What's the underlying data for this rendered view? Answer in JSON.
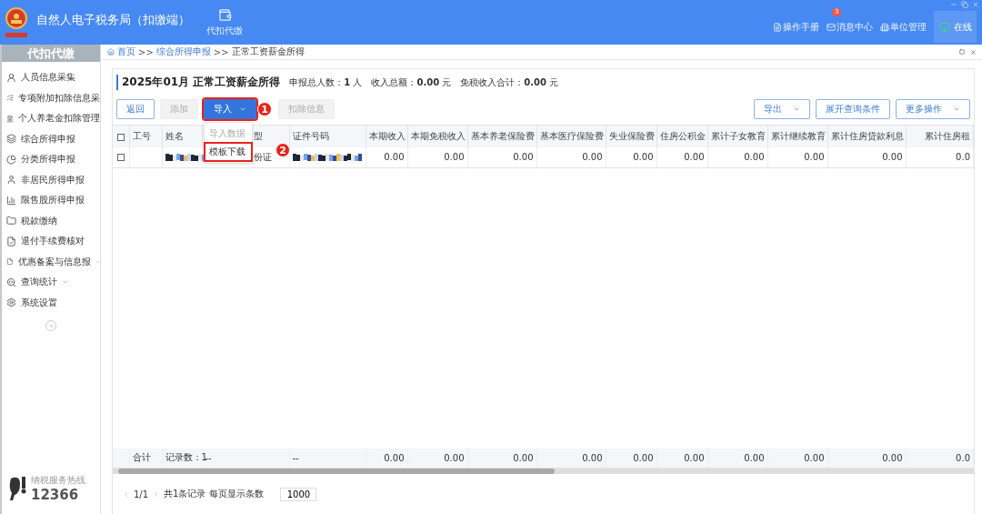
{
  "header": {
    "title": "自然人电子税务局（扣缴端）",
    "nav_tab": {
      "label": "代扣代缴",
      "selected": true
    },
    "links": [
      {
        "label": "操作手册"
      },
      {
        "label": "消息中心",
        "badge": "3"
      },
      {
        "label": "单位管理"
      }
    ],
    "status": "在线"
  },
  "sidebar": {
    "title": "代扣代缴",
    "items": [
      {
        "label": "人员信息采集",
        "expandable": false
      },
      {
        "label": "专项附加扣除信息采",
        "expandable": false
      },
      {
        "label": "个人养老金扣除管理",
        "expandable": false
      },
      {
        "label": "综合所得申报",
        "expandable": false
      },
      {
        "label": "分类所得申报",
        "expandable": false
      },
      {
        "label": "非居民所得申报",
        "expandable": false
      },
      {
        "label": "限售股所得申报",
        "expandable": false
      },
      {
        "label": "税款缴纳",
        "expandable": false
      },
      {
        "label": "退付手续费核对",
        "expandable": false
      },
      {
        "label": "优惠备案与信息报",
        "expandable": true
      },
      {
        "label": "查询统计",
        "expandable": true
      },
      {
        "label": "系统设置",
        "expandable": false
      }
    ],
    "hotline": {
      "caption": "纳税服务热线",
      "number": "12366"
    }
  },
  "breadcrumb": {
    "separator": ">>",
    "items": [
      "首页",
      "综合所得申报",
      "正常工资薪金所得"
    ]
  },
  "summary": {
    "title": "2025年01月 正常工资薪金所得",
    "stats": [
      {
        "label": "申报总人数：",
        "value": "1",
        "unit": "人"
      },
      {
        "label": "收入总额：",
        "value": "0.00",
        "unit": "元"
      },
      {
        "label": "免税收入合计：",
        "value": "0.00",
        "unit": "元"
      }
    ]
  },
  "toolbar": {
    "left": [
      {
        "label": "返回",
        "kind": "outline",
        "disabled": false,
        "dropdown": false,
        "highlighted": false
      },
      {
        "label": "添加",
        "kind": "plain",
        "disabled": true,
        "dropdown": false,
        "highlighted": false
      },
      {
        "label": "导入",
        "kind": "primary",
        "disabled": false,
        "dropdown": true,
        "highlighted": true,
        "callout": "1"
      },
      {
        "label": "扣除信息",
        "kind": "plain",
        "disabled": true,
        "dropdown": false,
        "highlighted": false
      }
    ],
    "right": [
      {
        "label": "导出",
        "dropdown": true
      },
      {
        "label": "展开查询条件",
        "dropdown": false
      },
      {
        "label": "更多操作",
        "dropdown": true
      }
    ]
  },
  "dropdown_menu": {
    "items": [
      {
        "label": "导入数据",
        "disabled": true,
        "highlighted": false
      },
      {
        "label": "模板下载",
        "disabled": false,
        "highlighted": true,
        "callout": "2"
      }
    ]
  },
  "table": {
    "header_checked": false,
    "columns": [
      "工号",
      "姓名",
      "型",
      "证件号码",
      "本期收入",
      "本期免税收入",
      "基本养老保险费",
      "基本医疗保险费",
      "失业保险费",
      "住房公积金",
      "累计子女教育",
      "累计继续教育",
      "累计住房贷款利息",
      "累计住房租"
    ],
    "rows": [
      {
        "checked": false,
        "cells": [
          null,
          {
            "kind": "redacted"
          },
          "份证",
          {
            "kind": "redacted"
          },
          "0.00",
          "0.00",
          "0.00",
          "0.00",
          "0.00",
          "0.00",
          "0.00",
          "0.00",
          "0.00",
          "0.0"
        ]
      }
    ],
    "totals": [
      "合计",
      "记录数：1",
      "--",
      "--",
      "0.00",
      "0.00",
      "0.00",
      "0.00",
      "0.00",
      "0.00",
      "0.00",
      "0.00",
      "0.00",
      "0.0"
    ]
  },
  "pagination": {
    "page": "1/1",
    "total": "共1条记录",
    "page_size_label": "每页显示条数",
    "page_size": "1000"
  }
}
